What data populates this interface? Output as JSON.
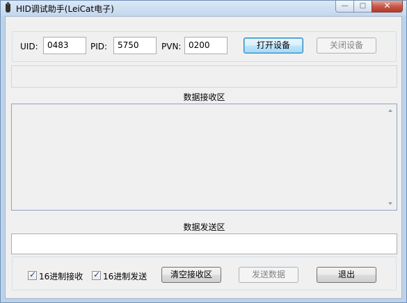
{
  "window": {
    "title": "HID调试助手(LeiCat电子)",
    "controls": {
      "minimize": "—",
      "maximize": "□",
      "close": "✕"
    }
  },
  "device": {
    "uid_label": "UID:",
    "uid_value": "0483",
    "pid_label": "PID:",
    "pid_value": "5750",
    "pvn_label": "PVN:",
    "pvn_value": "0200",
    "open_button": "打开设备",
    "close_button": "关闭设备"
  },
  "status": {
    "text": ""
  },
  "receive": {
    "title": "数据接收区",
    "content": ""
  },
  "send": {
    "title": "数据发送区",
    "value": ""
  },
  "options": {
    "hex_receive": {
      "label": "16进制接收",
      "checked": true
    },
    "hex_send": {
      "label": "16进制发送",
      "checked": true
    },
    "clear_button": "清空接收区",
    "send_button": "发送数据",
    "exit_button": "退出"
  },
  "colors": {
    "accent": "#3c7fb1",
    "close_button": "#c7594a",
    "frame": "#bcd2ea"
  }
}
